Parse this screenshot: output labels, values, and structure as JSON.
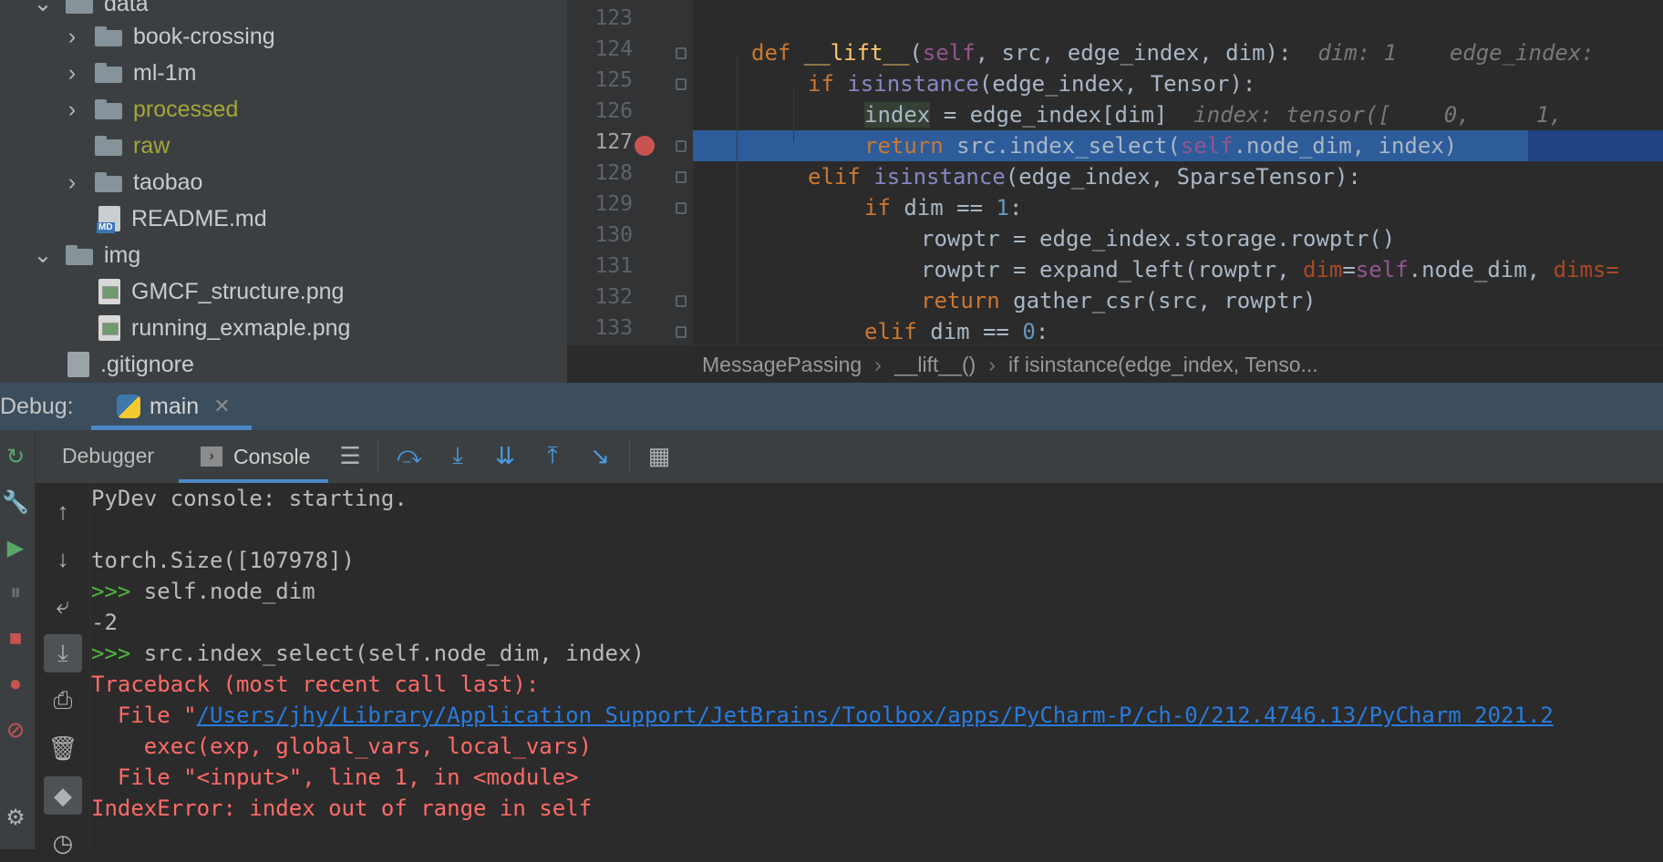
{
  "project_tree": {
    "items": [
      {
        "label": "data",
        "kind": "folder",
        "expanded": true,
        "level": 1,
        "color": "#c9ccce"
      },
      {
        "label": "book-crossing",
        "kind": "folder",
        "expanded": false,
        "level": 2,
        "color": "#c9ccce"
      },
      {
        "label": "ml-1m",
        "kind": "folder",
        "expanded": false,
        "level": 2,
        "color": "#c9ccce"
      },
      {
        "label": "processed",
        "kind": "folder",
        "expanded": false,
        "level": 2,
        "color": "#a3a63a"
      },
      {
        "label": "raw",
        "kind": "folder",
        "expanded": null,
        "level": 2,
        "color": "#a3a63a"
      },
      {
        "label": "taobao",
        "kind": "folder",
        "expanded": false,
        "level": 2,
        "color": "#c9ccce"
      },
      {
        "label": "README.md",
        "kind": "md",
        "level": 2,
        "color": "#c9ccce"
      },
      {
        "label": "img",
        "kind": "folder",
        "expanded": true,
        "level": 1,
        "color": "#c9ccce"
      },
      {
        "label": "GMCF_structure.png",
        "kind": "png",
        "level": 2,
        "color": "#c9ccce"
      },
      {
        "label": "running_exmaple.png",
        "kind": "png",
        "level": 2,
        "color": "#c9ccce"
      },
      {
        "label": ".gitignore",
        "kind": "git",
        "level": 0,
        "color": "#c9ccce"
      }
    ]
  },
  "editor": {
    "line_numbers": [
      "123",
      "124",
      "125",
      "126",
      "127",
      "128",
      "129",
      "130",
      "131",
      "132",
      "133"
    ],
    "current_line": "127",
    "code": {
      "l124": {
        "kw": "def ",
        "fn": "__lift__",
        "p1": "(",
        "self": "self",
        "rest": ", src, edge_index, dim):",
        "hint": "  dim: 1    edge_index:"
      },
      "l125": {
        "kw": "if ",
        "bi": "isinstance",
        "rest": "(edge_index, Tensor):"
      },
      "l126": {
        "a": "index",
        "rest": " = edge_index[dim]",
        "hint": "  index: tensor([    0,     1,"
      },
      "l127": {
        "kw": "return ",
        "a": "src.index_select(",
        "self": "self",
        "rest": ".node_dim, index)"
      },
      "l128": {
        "kw": "elif ",
        "bi": "isinstance",
        "rest": "(edge_index, SparseTensor):"
      },
      "l129": {
        "kw": "if ",
        "a": "dim == ",
        "num": "1",
        "rest": ":"
      },
      "l130": {
        "a": "rowptr = edge_index.storage.rowptr()"
      },
      "l131": {
        "a": "rowptr = expand_left(rowptr, ",
        "p": "dim",
        "b": "=",
        "self": "self",
        "c": ".node_dim, ",
        "p2": "dims="
      },
      "l132": {
        "kw": "return ",
        "a": "gather_csr(src, rowptr)"
      },
      "l133": {
        "kw": "elif ",
        "a": "dim == ",
        "num": "0",
        "rest": ":"
      }
    },
    "breadcrumbs": [
      "MessagePassing",
      "__lift__()",
      "if isinstance(edge_index, Tenso..."
    ]
  },
  "debug": {
    "label": "Debug:",
    "tab": "main",
    "toolbar": {
      "debugger": "Debugger",
      "console": "Console"
    }
  },
  "console": {
    "lines": {
      "l1": "PyDev console: starting.",
      "l2": "torch.Size([107978])",
      "l3_prompt": ">>> ",
      "l3": "self.node_dim",
      "l4": "-2",
      "l5_prompt": ">>> ",
      "l5": "src.index_select(self.node_dim, index)",
      "l6": "Traceback (most recent call last):",
      "l7_pre": "  File \"",
      "l7_link": "/Users/jhy/Library/Application Support/JetBrains/Toolbox/apps/PyCharm-P/ch-0/212.4746.13/PyCharm 2021.2",
      "l8": "    exec(exp, global_vars, local_vars)",
      "l9": "  File \"<input>\", line 1, in <module>",
      "l10": "IndexError: index out of range in self"
    }
  },
  "colors": {
    "accent": "#4a88c7",
    "error": "#ff6b68",
    "breakpoint": "#c75450",
    "link": "#287bde"
  }
}
